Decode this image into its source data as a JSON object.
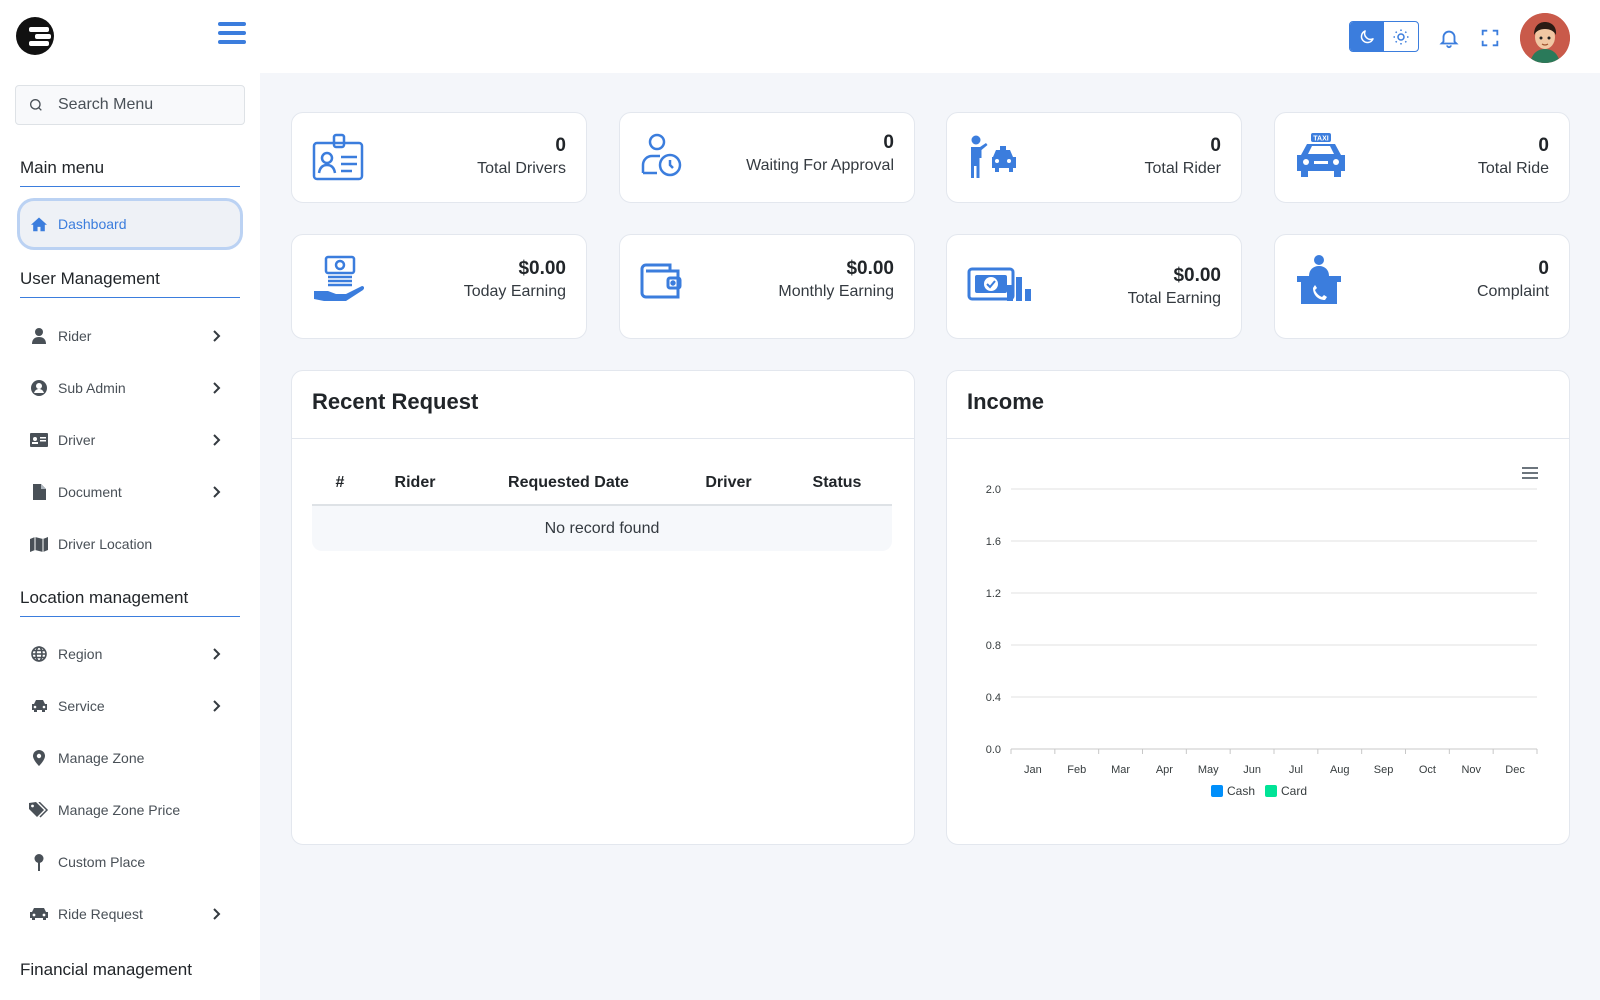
{
  "header": {
    "menu_icon": "hamburger-icon",
    "theme_options": [
      "moon-icon",
      "sun-icon"
    ],
    "icons": [
      "bell-icon",
      "fullscreen-icon"
    ]
  },
  "sidebar": {
    "search_placeholder": "Search Menu",
    "sections": [
      {
        "title": "Main menu"
      },
      {
        "title": "User Management"
      },
      {
        "title": "Location management"
      },
      {
        "title": "Financial management"
      }
    ],
    "items": [
      {
        "label": "Dashboard",
        "icon": "home-icon",
        "active": true
      },
      {
        "label": "Rider",
        "icon": "user-icon",
        "has_children": true
      },
      {
        "label": "Sub Admin",
        "icon": "user-circle-icon",
        "has_children": true
      },
      {
        "label": "Driver",
        "icon": "id-card-icon",
        "has_children": true
      },
      {
        "label": "Document",
        "icon": "file-icon",
        "has_children": true
      },
      {
        "label": "Driver Location",
        "icon": "map-icon",
        "has_children": false
      },
      {
        "label": "Region",
        "icon": "globe-icon",
        "has_children": true
      },
      {
        "label": "Service",
        "icon": "car-icon",
        "has_children": true
      },
      {
        "label": "Manage Zone",
        "icon": "location-pin-icon",
        "has_children": false
      },
      {
        "label": "Manage Zone Price",
        "icon": "tags-icon",
        "has_children": false
      },
      {
        "label": "Custom Place",
        "icon": "map-pin-icon",
        "has_children": false
      },
      {
        "label": "Ride Request",
        "icon": "taxi-icon",
        "has_children": true
      }
    ]
  },
  "stats": [
    {
      "value": "0",
      "label": "Total Drivers",
      "icon": "driver-id-card-icon"
    },
    {
      "value": "0",
      "label": "Waiting For Approval",
      "icon": "user-clock-icon"
    },
    {
      "value": "0",
      "label": "Total Rider",
      "icon": "person-taxi-icon"
    },
    {
      "value": "0",
      "label": "Total Ride",
      "icon": "taxi-icon"
    },
    {
      "value": "$0.00",
      "label": "Today Earning",
      "icon": "money-hand-icon"
    },
    {
      "value": "$0.00",
      "label": "Monthly Earning",
      "icon": "wallet-icon"
    },
    {
      "value": "$0.00",
      "label": "Total Earning",
      "icon": "money-chart-icon"
    },
    {
      "value": "0",
      "label": "Complaint",
      "icon": "complaint-desk-icon"
    }
  ],
  "recent_request": {
    "title": "Recent Request",
    "columns": [
      "#",
      "Rider",
      "Requested Date",
      "Driver",
      "Status"
    ],
    "empty_text": "No record found"
  },
  "income": {
    "title": "Income",
    "menu_icon": "chart-menu-icon"
  },
  "chart_data": {
    "type": "bar",
    "title": "",
    "xlabel": "",
    "ylabel": "",
    "categories": [
      "Jan",
      "Feb",
      "Mar",
      "Apr",
      "May",
      "Jun",
      "Jul",
      "Aug",
      "Sep",
      "Oct",
      "Nov",
      "Dec"
    ],
    "series": [
      {
        "name": "Cash",
        "color": "#008ffb",
        "values": [
          0,
          0,
          0,
          0,
          0,
          0,
          0,
          0,
          0,
          0,
          0,
          0
        ]
      },
      {
        "name": "Card",
        "color": "#00e396",
        "values": [
          0,
          0,
          0,
          0,
          0,
          0,
          0,
          0,
          0,
          0,
          0,
          0
        ]
      }
    ],
    "yticks": [
      "0.0",
      "0.4",
      "0.8",
      "1.2",
      "1.6",
      "2.0"
    ],
    "ylim": [
      0,
      2
    ],
    "grid": true,
    "legend": "bottom"
  },
  "colors": {
    "accent": "#3b7ddd",
    "cash": "#008ffb",
    "card": "#00e396"
  }
}
